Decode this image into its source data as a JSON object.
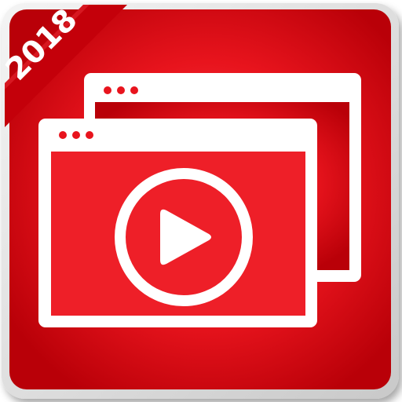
{
  "icon": {
    "badge_year": "2018",
    "semantic": "video-window-player-app-icon",
    "colors": {
      "primary_red": "#e8141d",
      "dark_red": "#b90008",
      "light_red": "#ff4a52",
      "white": "#ffffff",
      "frame_gray": "#d9d9d9"
    }
  }
}
